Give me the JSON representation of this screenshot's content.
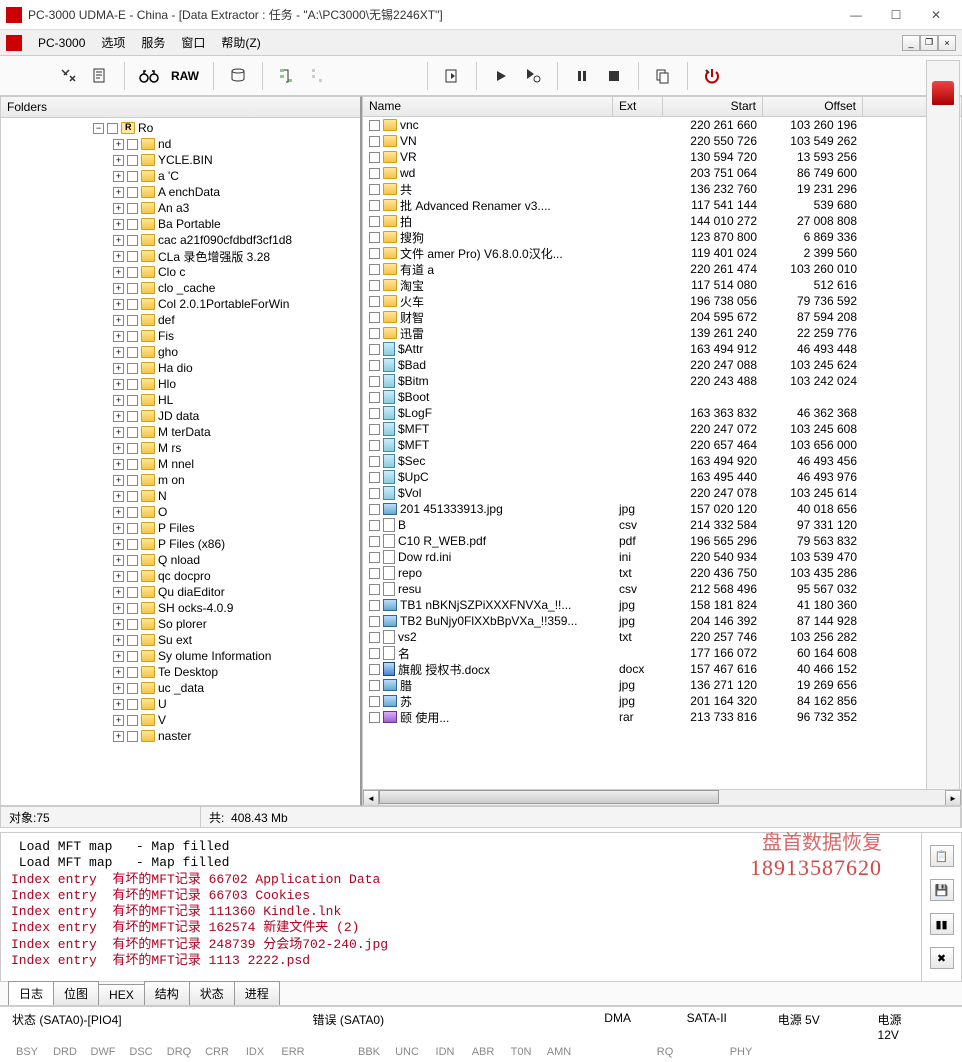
{
  "window": {
    "title": "PC-3000 UDMA-E - China - [Data Extractor : 任务 - \"A:\\PC3000\\无锡2246XT\"]"
  },
  "menu": {
    "app": "PC-3000",
    "options": "选项",
    "services": "服务",
    "window": "窗口",
    "help": "帮助(Z)"
  },
  "toolbar": {
    "raw": "RAW"
  },
  "left": {
    "header": "Folders",
    "root": "Ro",
    "items": [
      "nd",
      "YCLE.BIN",
      "a         'C",
      "A         enchData",
      "An        a3",
      "Ba          Portable",
      "cac        a21f090cfdbdf3cf1d8",
      "CLa       录色增强版 3.28",
      "Clo        c",
      "clo         _cache",
      "Col        2.0.1PortableForWin",
      "def",
      "Fis",
      "gho",
      "Ha          dio",
      "Hlo",
      "HL",
      "JD          data",
      "M          terData",
      "M          rs",
      "M           nnel",
      "m            on",
      "N",
      "O",
      "P            Files",
      "P           Files (x86)",
      "Q            nload",
      "qc          docpro",
      "Qu          diaEditor",
      "SH          ocks-4.0.9",
      "So          plorer",
      "Su          ext",
      "Sy           olume Information",
      "Te           Desktop",
      "uc           _data",
      "U",
      "V",
      "            naster"
    ]
  },
  "list": {
    "headers": {
      "name": "Name",
      "ext": "Ext",
      "start": "Start",
      "offset": "Offset"
    },
    "rows": [
      {
        "icon": "folder",
        "name": "vnc",
        "ext": "",
        "start": "220 261 660",
        "offset": "103 260 196"
      },
      {
        "icon": "folder",
        "name": "VN",
        "ext": "",
        "start": "220 550 726",
        "offset": "103 549 262"
      },
      {
        "icon": "folder",
        "name": "VR",
        "ext": "",
        "start": "130 594 720",
        "offset": "13 593 256"
      },
      {
        "icon": "folder",
        "name": "wd",
        "ext": "",
        "start": "203 751 064",
        "offset": "86 749 600"
      },
      {
        "icon": "folder",
        "name": "共",
        "ext": "",
        "start": "136 232 760",
        "offset": "19 231 296"
      },
      {
        "icon": "folder",
        "name": "批         Advanced Renamer v3....",
        "ext": "",
        "start": "117 541 144",
        "offset": "539 680"
      },
      {
        "icon": "folder",
        "name": "拍",
        "ext": "",
        "start": "144 010 272",
        "offset": "27 008 808"
      },
      {
        "icon": "folder",
        "name": "搜狗",
        "ext": "",
        "start": "123 870 800",
        "offset": "6 869 336"
      },
      {
        "icon": "folder",
        "name": "文件       amer Pro) V6.8.0.0汉化...",
        "ext": "",
        "start": "119 401 024",
        "offset": "2 399 560"
      },
      {
        "icon": "folder",
        "name": "有道        a",
        "ext": "",
        "start": "220 261 474",
        "offset": "103 260 010"
      },
      {
        "icon": "folder",
        "name": "淘宝",
        "ext": "",
        "start": "117 514 080",
        "offset": "512 616"
      },
      {
        "icon": "folder",
        "name": "火车",
        "ext": "",
        "start": "196 738 056",
        "offset": "79 736 592"
      },
      {
        "icon": "folder",
        "name": "财智",
        "ext": "",
        "start": "204 595 672",
        "offset": "87 594 208"
      },
      {
        "icon": "folder",
        "name": "迅雷",
        "ext": "",
        "start": "139 261 240",
        "offset": "22 259 776"
      },
      {
        "icon": "sys",
        "name": "$Attr",
        "ext": "",
        "start": "163 494 912",
        "offset": "46 493 448"
      },
      {
        "icon": "sys",
        "name": "$Bad",
        "ext": "",
        "start": "220 247 088",
        "offset": "103 245 624"
      },
      {
        "icon": "sys",
        "name": "$Bitm",
        "ext": "",
        "start": "220 243 488",
        "offset": "103 242 024"
      },
      {
        "icon": "sys",
        "name": "$Boot",
        "ext": "",
        "start": "",
        "offset": ""
      },
      {
        "icon": "sys",
        "name": "$LogF",
        "ext": "",
        "start": "163 363 832",
        "offset": "46 362 368"
      },
      {
        "icon": "sys",
        "name": "$MFT",
        "ext": "",
        "start": "220 247 072",
        "offset": "103 245 608"
      },
      {
        "icon": "sys",
        "name": "$MFT",
        "ext": "",
        "start": "220 657 464",
        "offset": "103 656 000"
      },
      {
        "icon": "sys",
        "name": "$Sec",
        "ext": "",
        "start": "163 494 920",
        "offset": "46 493 456"
      },
      {
        "icon": "sys",
        "name": "$UpC",
        "ext": "",
        "start": "163 495 440",
        "offset": "46 493 976"
      },
      {
        "icon": "sys",
        "name": "$Vol",
        "ext": "",
        "start": "220 247 078",
        "offset": "103 245 614"
      },
      {
        "icon": "img",
        "name": "201         451333913.jpg",
        "ext": "jpg",
        "start": "157 020 120",
        "offset": "40 018 656"
      },
      {
        "icon": "file",
        "name": "B",
        "ext": "csv",
        "start": "214 332 584",
        "offset": "97 331 120"
      },
      {
        "icon": "file",
        "name": "C10          R_WEB.pdf",
        "ext": "pdf",
        "start": "196 565 296",
        "offset": "79 563 832"
      },
      {
        "icon": "file",
        "name": "Dow          rd.ini",
        "ext": "ini",
        "start": "220 540 934",
        "offset": "103 539 470"
      },
      {
        "icon": "file",
        "name": "repo",
        "ext": "txt",
        "start": "220 436 750",
        "offset": "103 435 286"
      },
      {
        "icon": "file",
        "name": "resu",
        "ext": "csv",
        "start": "212 568 496",
        "offset": "95 567 032"
      },
      {
        "icon": "img",
        "name": "TB1          nBKNjSZPiXXXFNVXa_!!...",
        "ext": "jpg",
        "start": "158 181 824",
        "offset": "41 180 360"
      },
      {
        "icon": "img",
        "name": "TB2          BuNjy0FlXXbBpVXa_!!359...",
        "ext": "jpg",
        "start": "204 146 392",
        "offset": "87 144 928"
      },
      {
        "icon": "file",
        "name": "vs2",
        "ext": "txt",
        "start": "220 257 746",
        "offset": "103 256 282"
      },
      {
        "icon": "file",
        "name": "名",
        "ext": "",
        "start": "177 166 072",
        "offset": "60 164 608"
      },
      {
        "icon": "doc",
        "name": "旗舰         授权书.docx",
        "ext": "docx",
        "start": "157 467 616",
        "offset": "40 466 152"
      },
      {
        "icon": "img",
        "name": "腊",
        "ext": "jpg",
        "start": "136 271 120",
        "offset": "19 269 656"
      },
      {
        "icon": "img",
        "name": "苏",
        "ext": "jpg",
        "start": "201 164 320",
        "offset": "84 162 856"
      },
      {
        "icon": "rar",
        "name": "颐                       使用...",
        "ext": "rar",
        "start": "213 733 816",
        "offset": "96 732 352"
      }
    ]
  },
  "status": {
    "objects_label": "对象:",
    "objects_value": "75",
    "total_label": "共:",
    "total_value": "408.43 Mb"
  },
  "log": {
    "l1": " Load MFT map   - Map filled",
    "l2": " Load MFT map   - Map filled",
    "l3": "Index entry  有坏的MFT记录 66702 Application Data",
    "l4": "Index entry  有坏的MFT记录 66703 Cookies",
    "l5": "Index entry  有坏的MFT记录 111360 Kindle.lnk",
    "l6": "Index entry  有坏的MFT记录 162574 新建文件夹 (2)",
    "l7": "Index entry  有坏的MFT记录 248739 分会场702-240.jpg",
    "l8": "Index entry  有坏的MFT记录 1113 2222.psd"
  },
  "tabs": {
    "t1": "日志",
    "t2": "位图",
    "t3": "HEX",
    "t4": "结构",
    "t5": "状态",
    "t6": "进程"
  },
  "bottom": {
    "status_label": "状态 (SATA0)-[PIO4]",
    "error_label": "错误 (SATA0)",
    "dma": "DMA",
    "sata2": "SATA-II",
    "pwr5": "电源 5V",
    "pwr12": "电源 12V",
    "inds1": [
      "BSY",
      "DRD",
      "DWF",
      "DSC",
      "DRQ",
      "CRR",
      "IDX",
      "ERR"
    ],
    "inds2": [
      "BBK",
      "UNC",
      "IDN",
      "ABR",
      "T0N",
      "AMN"
    ],
    "inds3": [
      "RQ"
    ],
    "inds4": [
      "PHY"
    ]
  },
  "watermark": {
    "text": "盘首数据恢复",
    "phone": "18913587620"
  }
}
